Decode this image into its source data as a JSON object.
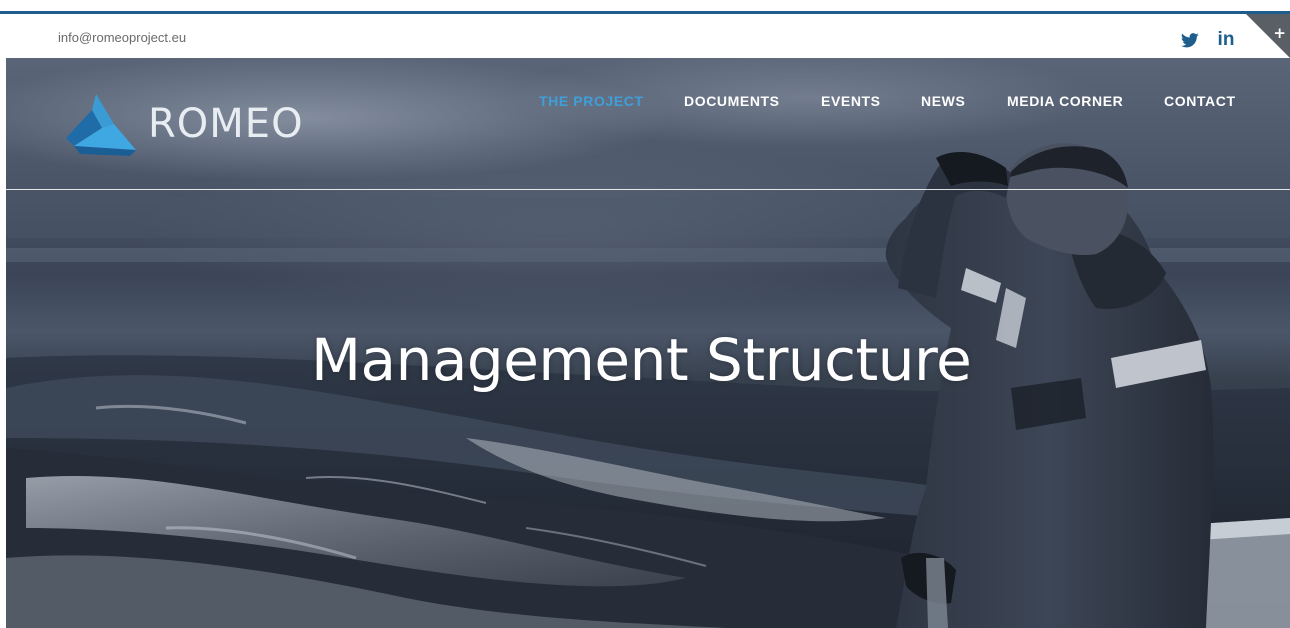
{
  "topbar": {
    "email": "info@romeoproject.eu",
    "social_icons": [
      "twitter-icon",
      "linkedin-icon"
    ],
    "linkedin_text": "in",
    "corner_symbol": "+"
  },
  "brand": {
    "name": "ROMEO",
    "logo_icon": "triangle-logo-icon",
    "logo_color": "#3a9bd5"
  },
  "nav": {
    "items": [
      {
        "label": "THE PROJECT",
        "active": true
      },
      {
        "label": "DOCUMENTS",
        "active": false
      },
      {
        "label": "EVENTS",
        "active": false
      },
      {
        "label": "NEWS",
        "active": false
      },
      {
        "label": "MEDIA CORNER",
        "active": false
      },
      {
        "label": "CONTACT",
        "active": false
      }
    ],
    "active_color": "#3f9fd8"
  },
  "hero": {
    "title": "Management Structure"
  },
  "colors": {
    "accent": "#1d5e8c",
    "twitter_blue": "#1d5e8c",
    "nav_text": "#ffffff"
  }
}
